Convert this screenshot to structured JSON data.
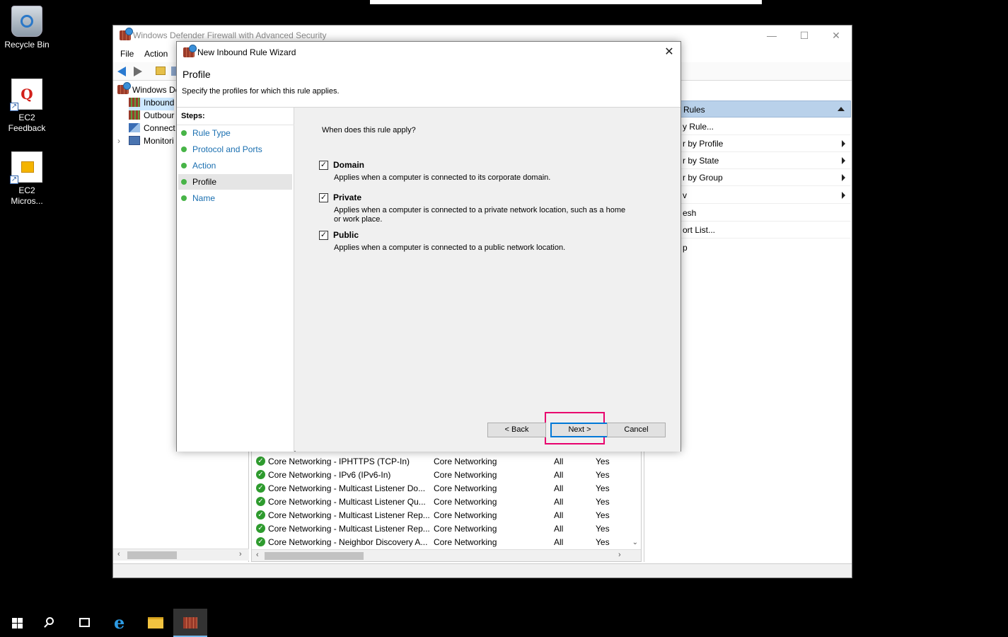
{
  "desktop": {
    "icons": [
      {
        "label": "Recycle Bin"
      },
      {
        "label": "EC2 Feedback"
      },
      {
        "label": "EC2 Micros..."
      }
    ]
  },
  "mmc": {
    "title": "Windows Defender Firewall with Advanced Security",
    "menu": [
      "File",
      "Action"
    ],
    "tree": [
      {
        "label": "Windows De"
      },
      {
        "label": "Inbound"
      },
      {
        "label": "Outbour"
      },
      {
        "label": "Connect"
      },
      {
        "label": "Monitori"
      }
    ],
    "rules": [
      {
        "name": "Core Networking - IPHTTPS (TCP-In)",
        "group": "Core Networking",
        "profile": "All",
        "enabled": "Yes"
      },
      {
        "name": "Core Networking - IPv6 (IPv6-In)",
        "group": "Core Networking",
        "profile": "All",
        "enabled": "Yes"
      },
      {
        "name": "Core Networking - Multicast Listener Do...",
        "group": "Core Networking",
        "profile": "All",
        "enabled": "Yes"
      },
      {
        "name": "Core Networking - Multicast Listener Qu...",
        "group": "Core Networking",
        "profile": "All",
        "enabled": "Yes"
      },
      {
        "name": "Core Networking - Multicast Listener Rep...",
        "group": "Core Networking",
        "profile": "All",
        "enabled": "Yes"
      },
      {
        "name": "Core Networking - Multicast Listener Rep...",
        "group": "Core Networking",
        "profile": "All",
        "enabled": "Yes"
      },
      {
        "name": "Core Networking - Neighbor Discovery A...",
        "group": "Core Networking",
        "profile": "All",
        "enabled": "Yes"
      }
    ],
    "actions": {
      "header": "Rules",
      "items": [
        "y Rule...",
        "r by Profile",
        "r by State",
        "r by Group",
        "v",
        "esh",
        "ort List...",
        "p"
      ]
    }
  },
  "wizard": {
    "title": "New Inbound Rule Wizard",
    "close": "✕",
    "heading": "Profile",
    "subheading": "Specify the profiles for which this rule applies.",
    "steps_header": "Steps:",
    "steps": [
      "Rule Type",
      "Protocol and Ports",
      "Action",
      "Profile",
      "Name"
    ],
    "current_step": "Profile",
    "question": "When does this rule apply?",
    "options": [
      {
        "name": "Domain",
        "checked": true,
        "description": "Applies when a computer is connected to its corporate domain."
      },
      {
        "name": "Private",
        "checked": true,
        "description": "Applies when a computer is connected to a private network location, such as a home or work place."
      },
      {
        "name": "Public",
        "checked": true,
        "description": "Applies when a computer is connected to a public network location."
      }
    ],
    "buttons": {
      "back": "< Back",
      "next": "Next >",
      "cancel": "Cancel"
    },
    "highlight_color": "#e8006e"
  },
  "taskbar": {
    "icons": [
      "start-icon",
      "search-icon",
      "task-view-icon",
      "internet-explorer-icon",
      "file-explorer-icon",
      "firewall-app-icon"
    ]
  }
}
